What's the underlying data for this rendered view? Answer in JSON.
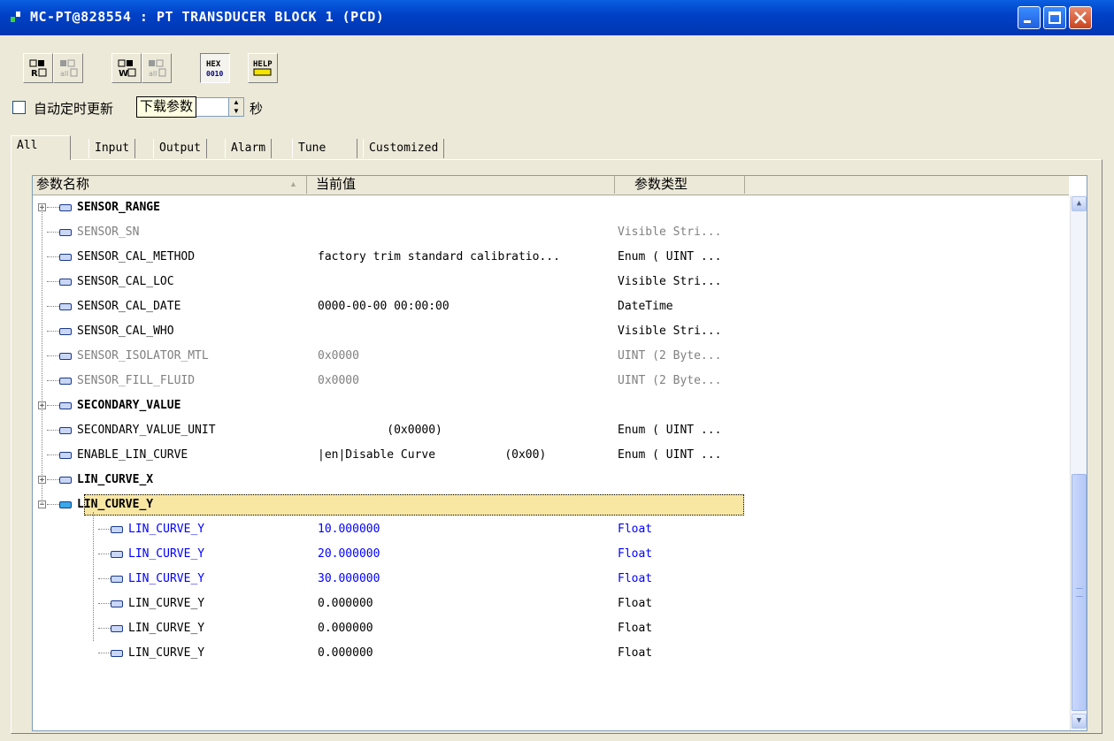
{
  "window": {
    "title": "MC-PT@828554 : PT TRANSDUCER BLOCK 1 (PCD)"
  },
  "toolbar": {
    "buttons": [
      {
        "name": "read-param-icon",
        "label": "R"
      },
      {
        "name": "read-all-icon",
        "label": "all"
      },
      {
        "name": "write-param-icon",
        "label": "W"
      },
      {
        "name": "write-all-icon",
        "label": "all"
      },
      {
        "name": "hex-icon",
        "label": "HEX 0010"
      },
      {
        "name": "help-icon",
        "label": "HELP"
      }
    ]
  },
  "auto_refresh": {
    "label": "自动定时更新",
    "unit": "秒",
    "tooltip": "下载参数"
  },
  "tabs": [
    "All",
    "Input",
    "Output",
    "Alarm",
    "Tune",
    "Customized"
  ],
  "grid": {
    "columns": [
      "参数名称",
      "当前值",
      "参数类型"
    ],
    "rows": [
      {
        "name": "SENSOR_RANGE",
        "value": "",
        "type": "",
        "style": "bold",
        "expander": "+"
      },
      {
        "name": "SENSOR_SN",
        "value": "",
        "type": "Visible Stri...",
        "style": "gray"
      },
      {
        "name": "SENSOR_CAL_METHOD",
        "value": "factory trim standard calibratio...",
        "type": "Enum ( UINT ...",
        "style": "normal"
      },
      {
        "name": "SENSOR_CAL_LOC",
        "value": "",
        "type": "Visible Stri...",
        "style": "normal"
      },
      {
        "name": "SENSOR_CAL_DATE",
        "value": "0000-00-00 00:00:00",
        "type": "DateTime",
        "style": "normal"
      },
      {
        "name": "SENSOR_CAL_WHO",
        "value": "",
        "type": "Visible Stri...",
        "style": "normal"
      },
      {
        "name": "SENSOR_ISOLATOR_MTL",
        "value": "0x0000",
        "type": "UINT (2 Byte...",
        "style": "gray"
      },
      {
        "name": "SENSOR_FILL_FLUID",
        "value": "0x0000",
        "type": "UINT (2 Byte...",
        "style": "gray"
      },
      {
        "name": "SECONDARY_VALUE",
        "value": "",
        "type": "",
        "style": "bold",
        "expander": "+"
      },
      {
        "name": "SECONDARY_VALUE_UNIT",
        "value": "          (0x0000)",
        "type": "Enum ( UINT ...",
        "style": "normal"
      },
      {
        "name": "ENABLE_LIN_CURVE",
        "value": "|en|Disable Curve          (0x00)",
        "type": "Enum ( UINT ...",
        "style": "normal"
      },
      {
        "name": "LIN_CURVE_X",
        "value": "",
        "type": "",
        "style": "bold",
        "expander": "+"
      },
      {
        "name": "LIN_CURVE_Y",
        "value": "",
        "type": "",
        "style": "bold-selected",
        "expander": "−"
      },
      {
        "name": "LIN_CURVE_Y",
        "value": "10.000000",
        "type": "Float",
        "style": "blue",
        "child": true
      },
      {
        "name": "LIN_CURVE_Y",
        "value": "20.000000",
        "type": "Float",
        "style": "blue",
        "child": true
      },
      {
        "name": "LIN_CURVE_Y",
        "value": "30.000000",
        "type": "Float",
        "style": "blue",
        "child": true
      },
      {
        "name": "LIN_CURVE_Y",
        "value": "0.000000",
        "type": "Float",
        "style": "normal",
        "child": true
      },
      {
        "name": "LIN_CURVE_Y",
        "value": "0.000000",
        "type": "Float",
        "style": "normal",
        "child": true
      },
      {
        "name": "LIN_CURVE_Y",
        "value": "0.000000",
        "type": "Float",
        "style": "normal",
        "child": true
      }
    ]
  }
}
